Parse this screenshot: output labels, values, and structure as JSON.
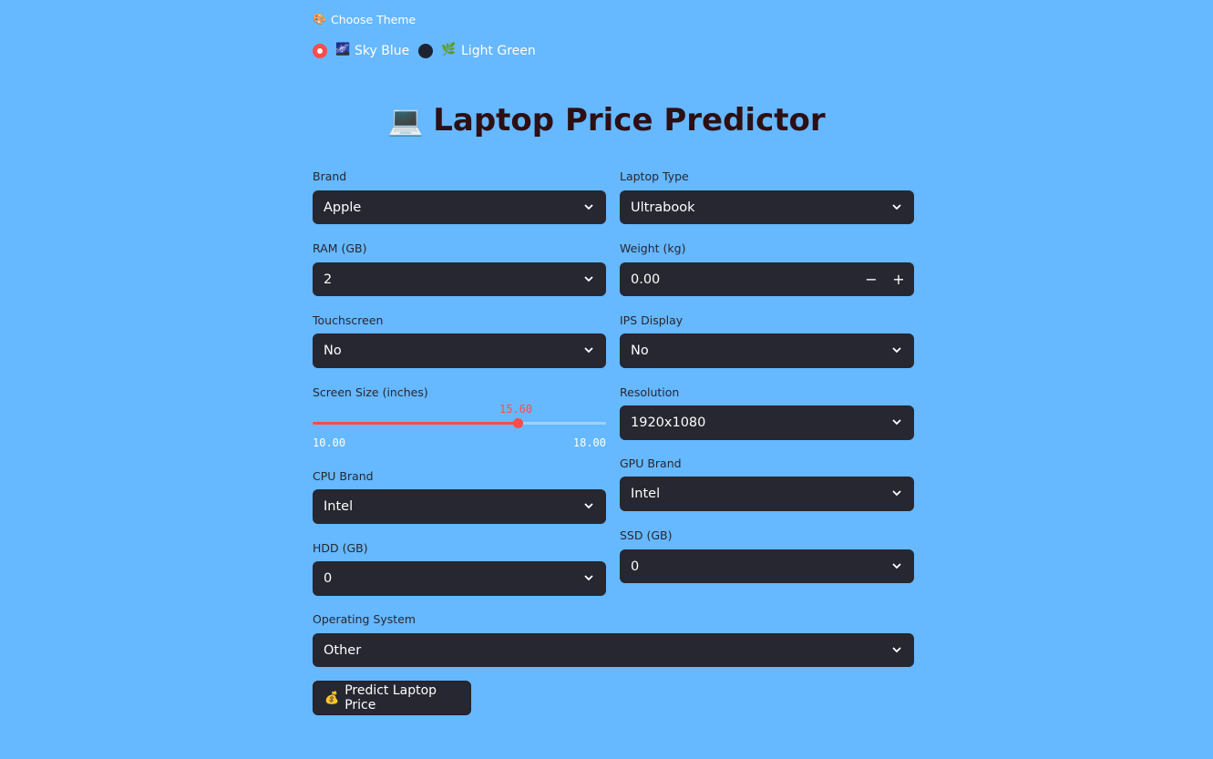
{
  "theme": {
    "label": "Choose Theme",
    "label_icon": "palette-icon",
    "options": [
      {
        "icon": "sky-icon",
        "label": "Sky Blue",
        "selected": true
      },
      {
        "icon": "herb-icon",
        "label": "Light Green",
        "selected": false
      }
    ]
  },
  "title": {
    "icon": "laptop-icon",
    "text": "Laptop Price Predictor"
  },
  "fields": {
    "brand": {
      "label": "Brand",
      "value": "Apple"
    },
    "laptop_type": {
      "label": "Laptop Type",
      "value": "Ultrabook"
    },
    "ram": {
      "label": "RAM (GB)",
      "value": "2"
    },
    "weight": {
      "label": "Weight (kg)",
      "value": "0.00",
      "minus": "−",
      "plus": "+"
    },
    "touchscreen": {
      "label": "Touchscreen",
      "value": "No"
    },
    "ips": {
      "label": "IPS Display",
      "value": "No"
    },
    "screen_size": {
      "label": "Screen Size (inches)",
      "value": "15.60",
      "min": "10.00",
      "max": "18.00",
      "fraction": 0.7
    },
    "resolution": {
      "label": "Resolution",
      "value": "1920x1080"
    },
    "cpu": {
      "label": "CPU Brand",
      "value": "Intel"
    },
    "gpu": {
      "label": "GPU Brand",
      "value": "Intel"
    },
    "hdd": {
      "label": "HDD (GB)",
      "value": "0"
    },
    "ssd": {
      "label": "SSD (GB)",
      "value": "0"
    },
    "os": {
      "label": "Operating System",
      "value": "Other"
    }
  },
  "predict_button": {
    "icon": "money-bag-icon",
    "label": "Predict Laptop Price"
  },
  "colors": {
    "background": "#66b8ff",
    "widget": "#262730",
    "accent": "#ff4b4b"
  }
}
